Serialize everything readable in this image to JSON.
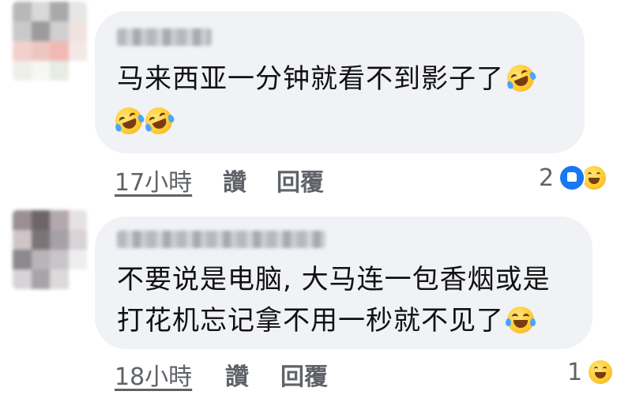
{
  "comments": [
    {
      "text_line1": "马来西亚一分钟就看不到影子了",
      "text_line2": "",
      "time": "17小時",
      "like_label": "讚",
      "reply_label": "回覆",
      "reaction_count": "2",
      "reactions": [
        "like-icon",
        "haha-icon"
      ],
      "inline_emojis": [
        "rofl-emoji-icon",
        "rofl-emoji-icon",
        "rofl-emoji-icon"
      ]
    },
    {
      "text_line1": "不要说是电脑, 大马连一包香烟或是",
      "text_line2": "打花机忘记拿不用一秒就不见了",
      "time": "18小時",
      "like_label": "讚",
      "reply_label": "回覆",
      "reaction_count": "1",
      "reactions": [
        "haha-icon"
      ],
      "inline_emojis": [
        "joy-emoji-icon"
      ]
    }
  ],
  "colors": {
    "bubble": "#f0f2f5",
    "text": "#111111",
    "meta": "#5f6368",
    "like_blue": "#1877f2"
  }
}
